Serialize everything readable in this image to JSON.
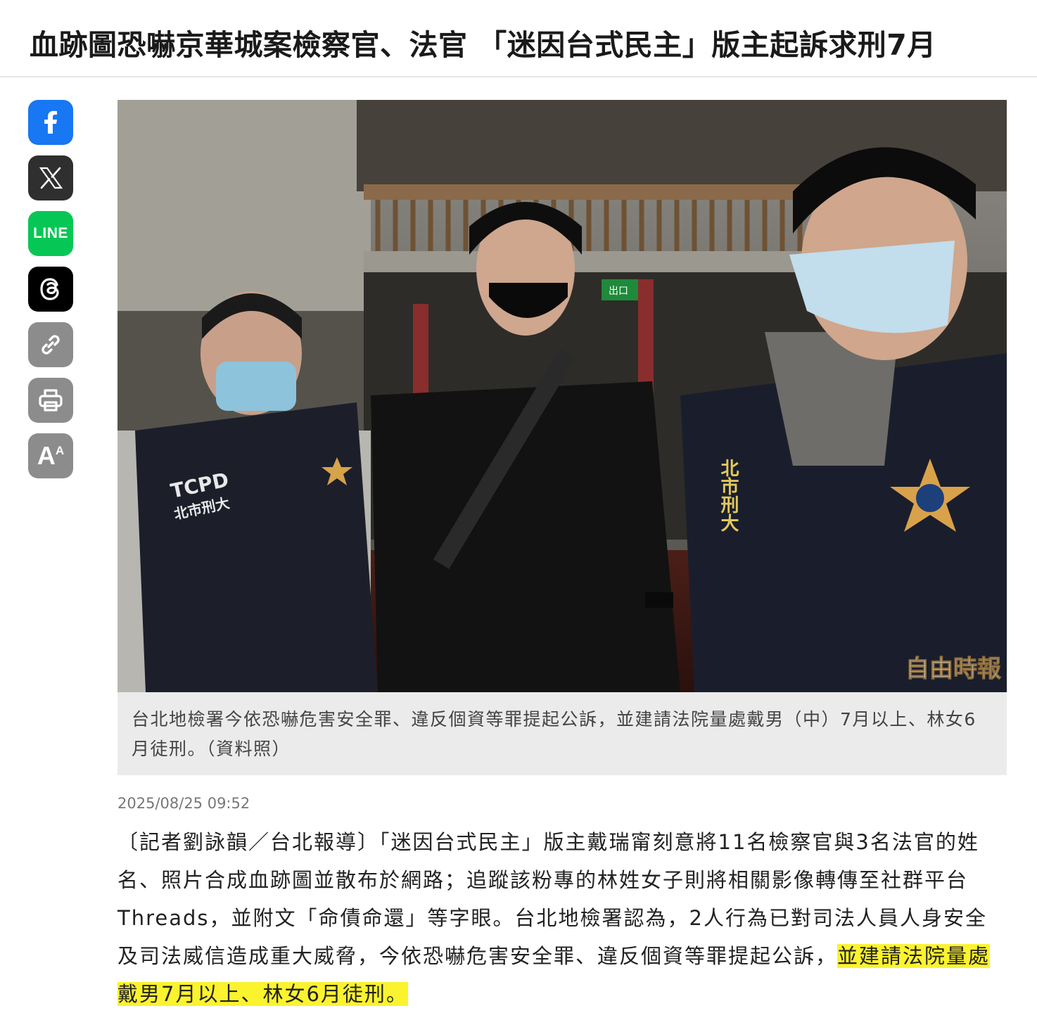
{
  "headline": "血跡圖恐嚇京華城案檢察官、法官 「迷因台式民主」版主起訴求刑7月",
  "share": {
    "facebook_icon": "facebook-icon",
    "x_icon": "x-icon",
    "line_label": "LINE",
    "threads_icon": "threads-icon",
    "link_icon": "link-icon",
    "print_icon": "print-icon",
    "font_size_label": "A",
    "font_size_sup": "A",
    "colors": {
      "facebook": "#1877f2",
      "x": "#2f2f2f",
      "line": "#06c755",
      "threads": "#000000",
      "utility": "#8c8c8c"
    }
  },
  "photo": {
    "watermark": "自由時報",
    "vest_left": "TCPD",
    "vest_left_sub": "北市刑大",
    "vest_right": "北市刑大",
    "exit_sign": "出口"
  },
  "caption": "台北地檢署今依恐嚇危害安全罪、違反個資等罪提起公訴，並建請法院量處戴男（中）7月以上、林女6月徒刑。（資料照）",
  "date": "2025/08/25 09:52",
  "article": {
    "body": "〔記者劉詠韻／台北報導〕「迷因台式民主」版主戴瑞甯刻意將11名檢察官與3名法官的姓名、照片合成血跡圖並散布於網路；追蹤該粉專的林姓女子則將相關影像轉傳至社群平台Threads，並附文「命債命還」等字眼。台北地檢署認為，2人行為已對司法人員人身安全及司法威信造成重大威脅，今依恐嚇危害安全罪、違反個資等罪提起公訴，",
    "highlight": "並建請法院量處戴男7月以上、林女6月徒刑。"
  }
}
